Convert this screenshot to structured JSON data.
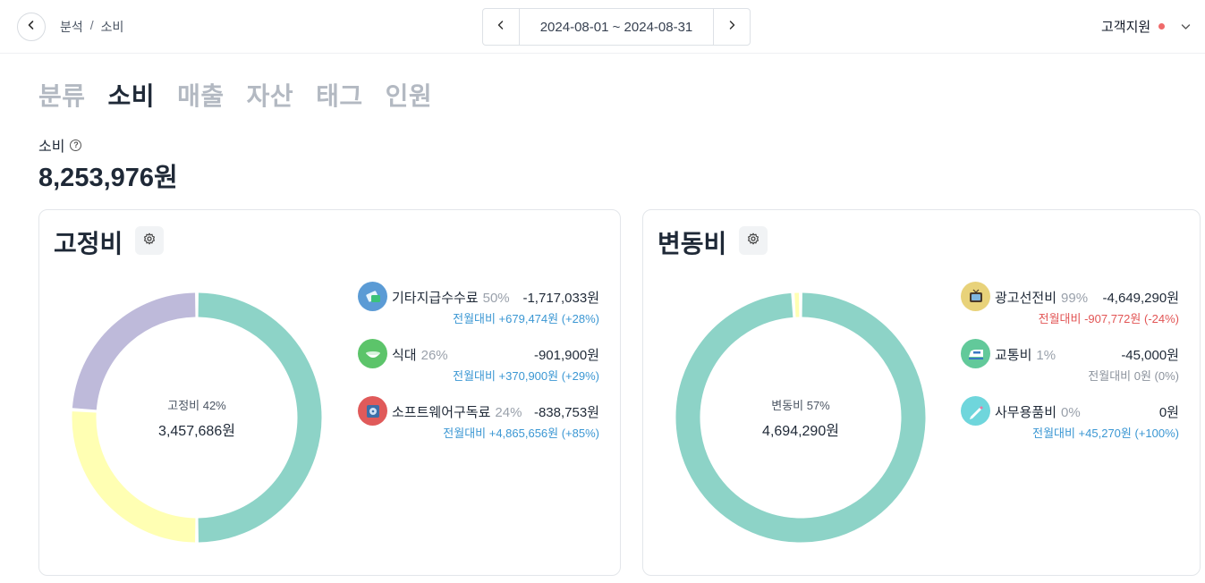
{
  "breadcrumb": {
    "parent": "분석",
    "separator": "/",
    "current": "소비"
  },
  "date_range": "2024-08-01 ~ 2024-08-31",
  "support": {
    "label": "고객지원"
  },
  "tabs": [
    {
      "label": "분류",
      "active": false
    },
    {
      "label": "소비",
      "active": true
    },
    {
      "label": "매출",
      "active": false
    },
    {
      "label": "자산",
      "active": false
    },
    {
      "label": "태그",
      "active": false
    },
    {
      "label": "인원",
      "active": false
    }
  ],
  "summary": {
    "label": "소비",
    "total": "8,253,976원"
  },
  "fixed_card": {
    "title": "고정비",
    "center_label": "고정비 42%",
    "center_value": "3,457,686원",
    "items": [
      {
        "name": "기타지급수수료",
        "pct": "50%",
        "amount": "-1,717,033원",
        "diff": "전월대비 +679,474원 (+28%)",
        "diff_tone": "blue",
        "color": "#8dd3c7",
        "share": 0.5,
        "icon": "payment-icon",
        "icon_bg": "#5b9bd5"
      },
      {
        "name": "식대",
        "pct": "26%",
        "amount": "-901,900원",
        "diff": "전월대비 +370,900원 (+29%)",
        "diff_tone": "blue",
        "color": "#ffffb3",
        "share": 0.26,
        "icon": "food-bowl-icon",
        "icon_bg": "#5cc46a"
      },
      {
        "name": "소프트웨어구독료",
        "pct": "24%",
        "amount": "-838,753원",
        "diff": "전월대비 +4,865,656원 (+85%)",
        "diff_tone": "blue",
        "color": "#bebada",
        "share": 0.24,
        "icon": "software-disk-icon",
        "icon_bg": "#e05a5a"
      }
    ]
  },
  "variable_card": {
    "title": "변동비",
    "center_label": "변동비 57%",
    "center_value": "4,694,290원",
    "items": [
      {
        "name": "광고선전비",
        "pct": "99%",
        "amount": "-4,649,290원",
        "diff": "전월대비 -907,772원 (-24%)",
        "diff_tone": "red",
        "color": "#8dd3c7",
        "share": 0.99,
        "icon": "tv-icon",
        "icon_bg": "#e8d27a"
      },
      {
        "name": "교통비",
        "pct": "1%",
        "amount": "-45,000원",
        "diff": "전월대비 0원 (0%)",
        "diff_tone": "gray",
        "color": "#ffffb3",
        "share": 0.01,
        "icon": "train-icon",
        "icon_bg": "#62c99a"
      },
      {
        "name": "사무용품비",
        "pct": "0%",
        "amount": "0원",
        "diff": "전월대비 +45,270원 (+100%)",
        "diff_tone": "blue",
        "color": "#bebada",
        "share": 0.0,
        "icon": "pen-icon",
        "icon_bg": "#6fd6dc"
      }
    ]
  }
}
